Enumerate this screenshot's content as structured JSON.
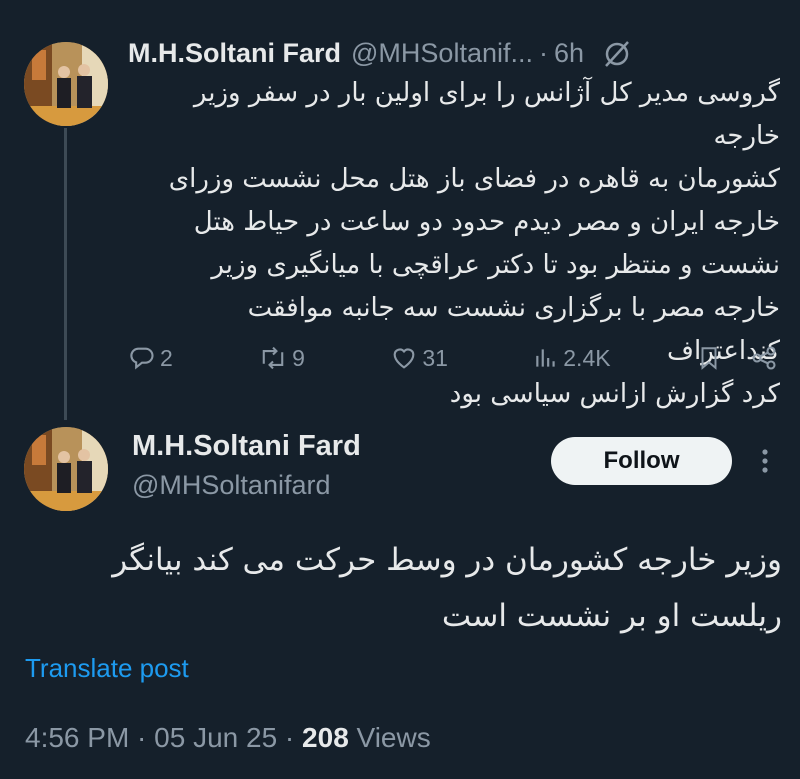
{
  "colors": {
    "background": "#15202b",
    "text": "#e7e9ea",
    "muted": "#8b98a5",
    "link": "#1d9bf0",
    "button_bg": "#eff3f4"
  },
  "tweet1": {
    "name": "M.H.Soltani Fard",
    "handle": "@MHSoltanif...",
    "separator": "·",
    "time": "6h",
    "body_lines": [
      "گروسی مدیر کل آژانس را برای اولین بار در سفر وزیر خارجه",
      "کشورمان به قاهره در فضای باز هتل محل نشست وزرای",
      "خارجه ایران و مصر دیدم حدود دو ساعت در حیاط هتل",
      "نشست و منتظر بود تا دکتر عراقچی با میانگیری وزیر",
      "خارجه مصر با برگزاری نشست سه جانبه موافقت کنداعتراف",
      "کرد گزارش ازانس سیاسی بود"
    ],
    "actions": {
      "replies": "2",
      "reposts": "9",
      "likes": "31",
      "views": "2.4K"
    }
  },
  "tweet2": {
    "name": "M.H.Soltani Fard",
    "handle": "@MHSoltanifard",
    "follow_label": "Follow",
    "body_lines": [
      "وزیر خارجه کشورمان در وسط حرکت می کند بیانگر",
      "ریلست او بر نشست است"
    ],
    "translate_label": "Translate post",
    "timestamp": "4:56 PM · 05 Jun 25 · ",
    "views_count": "208",
    "views_label": " Views"
  }
}
